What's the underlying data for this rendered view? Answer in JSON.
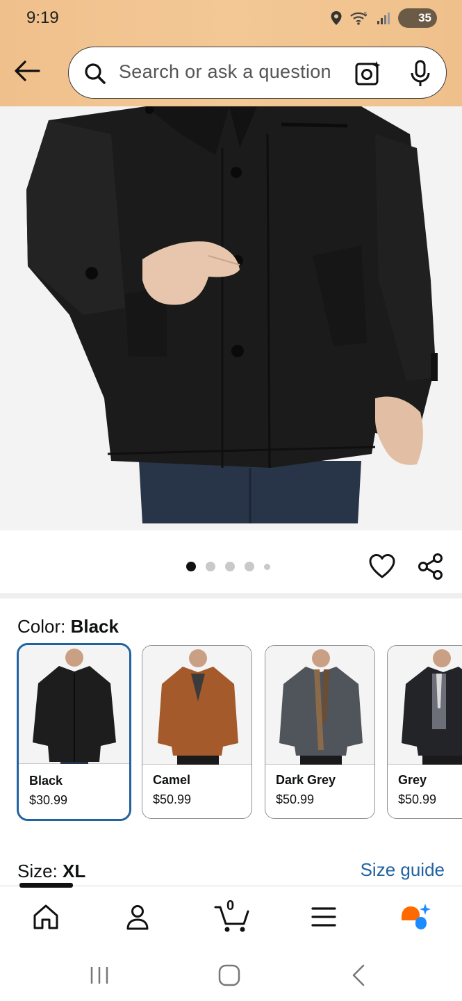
{
  "status_bar": {
    "time": "9:19",
    "battery": "35"
  },
  "search": {
    "placeholder": "Search or ask a question"
  },
  "gallery": {
    "dot_count": 5,
    "active_index": 0
  },
  "color": {
    "label": "Color: ",
    "selected": "Black",
    "options": [
      {
        "name": "Black",
        "price": "$30.99",
        "coat_color": "#1c1d1c"
      },
      {
        "name": "Camel",
        "price": "$50.99",
        "coat_color": "#a45a2a"
      },
      {
        "name": "Dark Grey",
        "price": "$50.99",
        "coat_color": "#50545b"
      },
      {
        "name": "Grey",
        "price": "$50.99",
        "coat_color": "#232428"
      }
    ]
  },
  "size": {
    "label": "Size: ",
    "selected": "XL",
    "guide_label": "Size guide"
  },
  "cart": {
    "count": "0"
  },
  "colors": {
    "header_bg": "#f3c895",
    "accent_blue": "#2162a1",
    "rufus_orange": "#ff6a00",
    "rufus_blue": "#1a8cff"
  }
}
